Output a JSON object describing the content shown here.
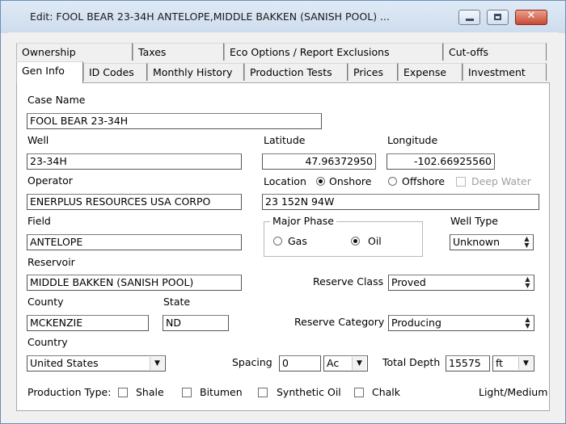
{
  "window": {
    "title": "Edit: FOOL BEAR 23-34H        ANTELOPE,MIDDLE BAKKEN (SANISH POOL) ...",
    "minimize_glyph": "▁",
    "restore_glyph": "▢",
    "close_glyph": "✕"
  },
  "tabs": {
    "row_back": [
      "Ownership",
      "Taxes",
      "Eco Options / Report Exclusions",
      "Cut-offs"
    ],
    "row_front": [
      "Gen Info",
      "ID Codes",
      "Monthly History",
      "Production Tests",
      "Prices",
      "Expense",
      "Investment"
    ],
    "active": "Gen Info"
  },
  "form": {
    "case_name_label": "Case Name",
    "case_name_value": "FOOL BEAR 23-34H",
    "well_label": "Well",
    "well_value": "23-34H",
    "latitude_label": "Latitude",
    "latitude_value": "47.96372950",
    "longitude_label": "Longitude",
    "longitude_value": "-102.66925560",
    "operator_label": "Operator",
    "operator_value": "ENERPLUS RESOURCES USA CORPO",
    "location_label": "Location",
    "onshore_label": "Onshore",
    "offshore_label": "Offshore",
    "deep_water_label": "Deep Water",
    "location_selected": "Onshore",
    "location_value": "23  152N  94W",
    "field_label": "Field",
    "field_value": "ANTELOPE",
    "major_phase_label": "Major Phase",
    "gas_label": "Gas",
    "oil_label": "Oil",
    "major_phase_selected": "Oil",
    "well_type_label": "Well Type",
    "well_type_value": "Unknown",
    "reservoir_label": "Reservoir",
    "reservoir_value": "MIDDLE BAKKEN (SANISH POOL)",
    "reserve_class_label": "Reserve Class",
    "reserve_class_value": "Proved",
    "county_label": "County",
    "county_value": "MCKENZIE",
    "state_label": "State",
    "state_value": "ND",
    "reserve_category_label": "Reserve Category",
    "reserve_category_value": "Producing",
    "country_label": "Country",
    "country_value": "United States",
    "spacing_label": "Spacing",
    "spacing_value": "0",
    "spacing_unit": "Ac",
    "total_depth_label": "Total Depth",
    "total_depth_value": "15575",
    "total_depth_unit": "ft",
    "production_type_label": "Production Type:",
    "production_types": [
      "Shale",
      "Bitumen",
      "Synthetic Oil",
      "Chalk"
    ],
    "light_medium_label": "Light/Medium"
  },
  "icons": {
    "spin": "▲▼",
    "dropdown": "▼"
  }
}
